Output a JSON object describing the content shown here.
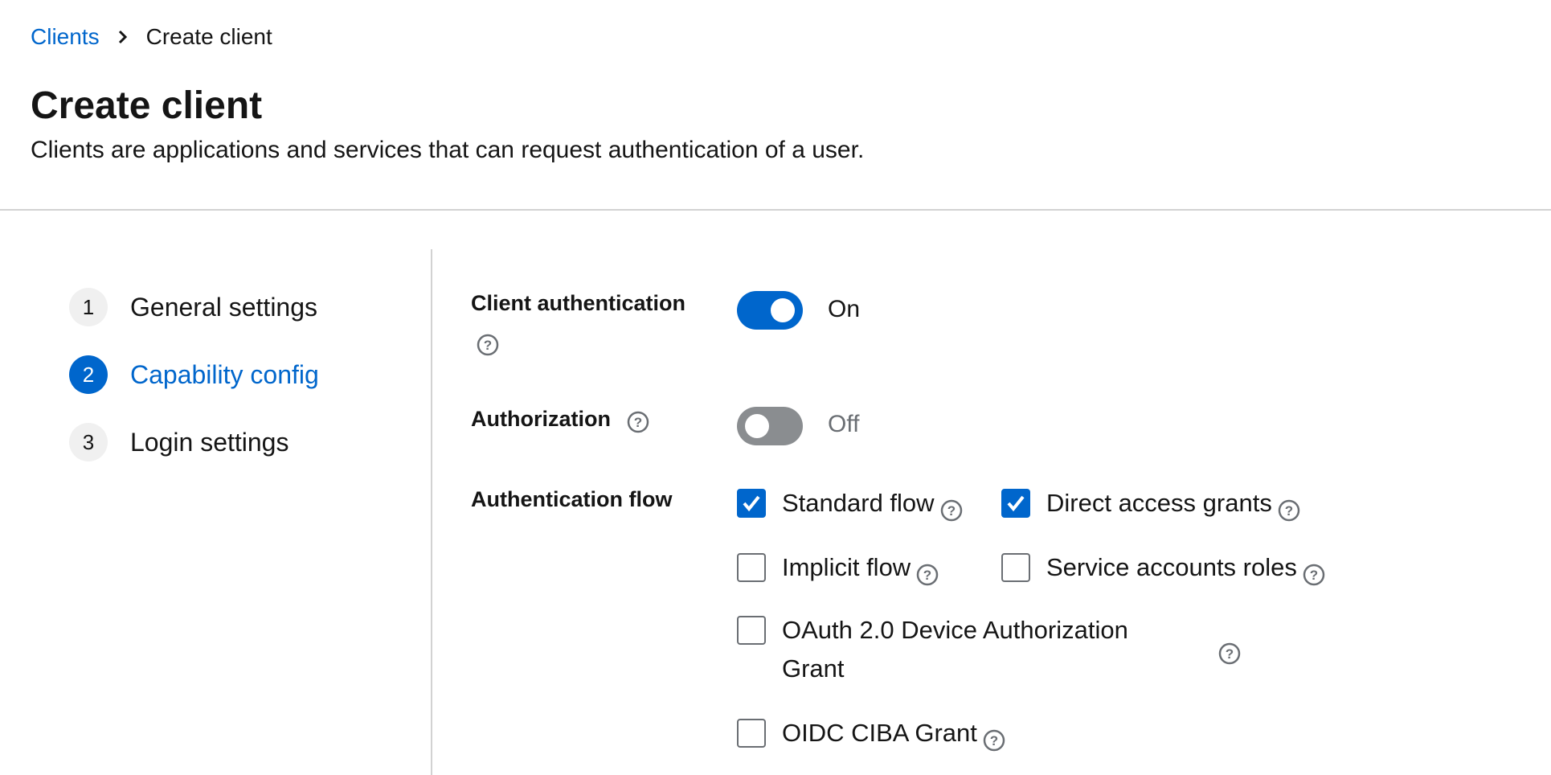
{
  "breadcrumb": {
    "parent": "Clients",
    "current": "Create client"
  },
  "page": {
    "title": "Create client",
    "description": "Clients are applications and services that can request authentication of a user."
  },
  "wizard": {
    "steps": [
      {
        "number": "1",
        "label": "General settings",
        "active": false
      },
      {
        "number": "2",
        "label": "Capability config",
        "active": true
      },
      {
        "number": "3",
        "label": "Login settings",
        "active": false
      }
    ]
  },
  "form": {
    "client_authentication": {
      "label": "Client authentication",
      "enabled": true,
      "state_text": "On"
    },
    "authorization": {
      "label": "Authorization",
      "enabled": false,
      "state_text": "Off"
    },
    "authentication_flow": {
      "label": "Authentication flow",
      "options": [
        {
          "label": "Standard flow",
          "checked": true
        },
        {
          "label": "Direct access grants",
          "checked": true
        },
        {
          "label": "Implicit flow",
          "checked": false
        },
        {
          "label": "Service accounts roles",
          "checked": false
        },
        {
          "label_line1": "OAuth 2.0 Device Authorization",
          "label_line2": "Grant",
          "checked": false
        },
        {
          "label": "OIDC CIBA Grant",
          "checked": false
        }
      ]
    }
  },
  "colors": {
    "primary": "#0066cc",
    "toggle_off": "#8a8d90",
    "text": "#151515",
    "muted_text": "#6a6e73",
    "divider": "#d2d2d2"
  },
  "icons": {
    "breadcrumb_separator": "chevron-right-icon",
    "help": "help-circle-icon",
    "checkbox_check": "check-icon"
  }
}
